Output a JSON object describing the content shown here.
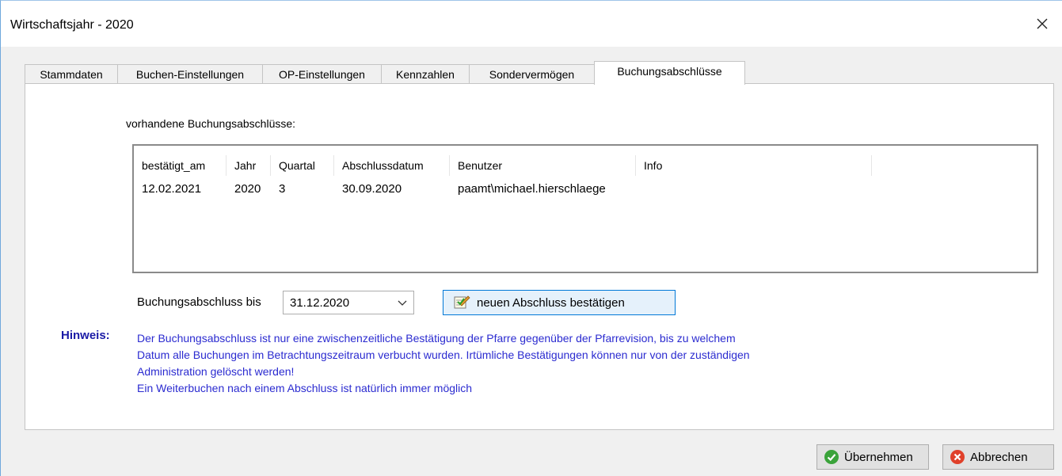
{
  "window": {
    "title": "Wirtschaftsjahr - 2020"
  },
  "tabs": [
    {
      "label": "Stammdaten"
    },
    {
      "label": "Buchen-Einstellungen"
    },
    {
      "label": "OP-Einstellungen"
    },
    {
      "label": "Kennzahlen"
    },
    {
      "label": "Sondervermögen"
    },
    {
      "label": "Buchungsabschlüsse",
      "active": true
    }
  ],
  "panel": {
    "existing_label": "vorhandene Buchungsabschlüsse:",
    "table": {
      "columns": [
        "bestätigt_am",
        "Jahr",
        "Quartal",
        "Abschlussdatum",
        "Benutzer",
        "Info"
      ],
      "rows": [
        [
          "12.02.2021",
          "2020",
          "3",
          "30.09.2020",
          "paamt\\michael.hierschlaege",
          ""
        ]
      ]
    },
    "bis_label": "Buchungsabschluss bis",
    "date_value": "31.12.2020",
    "confirm_label": "neuen Abschluss bestätigen",
    "hint_label": "Hinweis:",
    "hint_lines": [
      "Der Buchungsabschluss ist nur eine zwischenzeitliche Bestätigung der Pfarre gegenüber der Pfarrevision, bis zu welchem",
      "Datum alle Buchungen im Betrachtungszeitraum verbucht wurden. Irtümliche Bestätigungen können nur von der zuständigen",
      "Administration gelöscht werden!",
      "Ein Weiterbuchen nach einem Abschluss ist natürlich immer möglich"
    ]
  },
  "footer": {
    "ok_label": "Übernehmen",
    "cancel_label": "Abbrechen"
  },
  "icons": {
    "close": "close-icon",
    "confirm": "edit-check-icon",
    "ok": "green-check-icon",
    "cancel": "red-x-icon"
  },
  "colors": {
    "hint_text": "#2b2bd0",
    "hint_label": "#1a1aa6",
    "button_focus": "#0078d7"
  }
}
